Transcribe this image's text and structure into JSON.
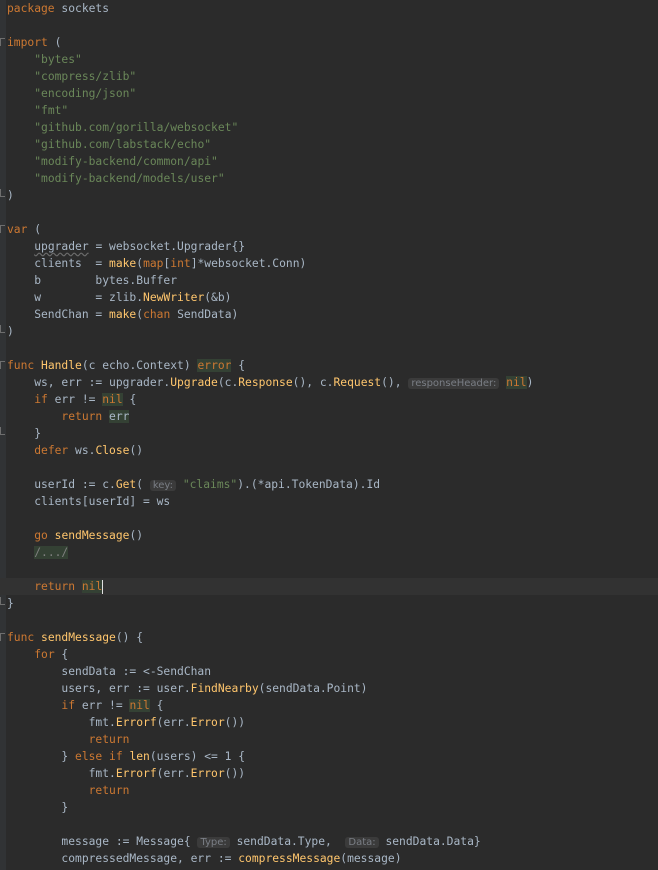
{
  "editor": {
    "lines": [
      [
        {
          "t": "package",
          "k": "kw"
        },
        {
          "t": " sockets",
          "k": "p"
        }
      ],
      [],
      [
        {
          "t": "import",
          "k": "kw"
        },
        {
          "t": " (",
          "k": "p"
        }
      ],
      [
        {
          "t": "    ",
          "k": "p"
        },
        {
          "t": "\"bytes\"",
          "k": "str"
        }
      ],
      [
        {
          "t": "    ",
          "k": "p"
        },
        {
          "t": "\"compress/zlib\"",
          "k": "str"
        }
      ],
      [
        {
          "t": "    ",
          "k": "p"
        },
        {
          "t": "\"encoding/json\"",
          "k": "str"
        }
      ],
      [
        {
          "t": "    ",
          "k": "p"
        },
        {
          "t": "\"fmt\"",
          "k": "str"
        }
      ],
      [
        {
          "t": "    ",
          "k": "p"
        },
        {
          "t": "\"github.com/gorilla/websocket\"",
          "k": "str"
        }
      ],
      [
        {
          "t": "    ",
          "k": "p"
        },
        {
          "t": "\"github.com/labstack/echo\"",
          "k": "str"
        }
      ],
      [
        {
          "t": "    ",
          "k": "p"
        },
        {
          "t": "\"modify-backend/common/api\"",
          "k": "str"
        }
      ],
      [
        {
          "t": "    ",
          "k": "p"
        },
        {
          "t": "\"modify-backend/models/user\"",
          "k": "str"
        }
      ],
      [
        {
          "t": ")",
          "k": "p"
        }
      ],
      [],
      [
        {
          "t": "var",
          "k": "kw"
        },
        {
          "t": " (",
          "k": "p"
        }
      ],
      [
        {
          "t": "    ",
          "k": "p"
        },
        {
          "t": "upgrader",
          "k": "sq"
        },
        {
          "t": " = websocket.Upgrader{}",
          "k": "p"
        }
      ],
      [
        {
          "t": "    clients  = ",
          "k": "p"
        },
        {
          "t": "make",
          "k": "fn"
        },
        {
          "t": "(",
          "k": "p"
        },
        {
          "t": "map",
          "k": "kw"
        },
        {
          "t": "[",
          "k": "p"
        },
        {
          "t": "int",
          "k": "kw"
        },
        {
          "t": "]*websocket.Conn)",
          "k": "p"
        }
      ],
      [
        {
          "t": "    b        bytes.Buffer",
          "k": "p"
        }
      ],
      [
        {
          "t": "    w        = zlib.",
          "k": "p"
        },
        {
          "t": "NewWriter",
          "k": "fn"
        },
        {
          "t": "(&b)",
          "k": "p"
        }
      ],
      [
        {
          "t": "    SendChan = ",
          "k": "p"
        },
        {
          "t": "make",
          "k": "fn"
        },
        {
          "t": "(",
          "k": "p"
        },
        {
          "t": "chan",
          "k": "kw"
        },
        {
          "t": " SendData)",
          "k": "p"
        }
      ],
      [
        {
          "t": ")",
          "k": "p"
        }
      ],
      [],
      [
        {
          "t": "func",
          "k": "kw"
        },
        {
          "t": " ",
          "k": "p"
        },
        {
          "t": "Handle",
          "k": "fn"
        },
        {
          "t": "(c echo.Context) ",
          "k": "p"
        },
        {
          "t": "error",
          "k": "kwhl"
        },
        {
          "t": " {",
          "k": "p"
        }
      ],
      [
        {
          "t": "    ws, err := upgrader.",
          "k": "p"
        },
        {
          "t": "Upgrade",
          "k": "fn"
        },
        {
          "t": "(c.",
          "k": "p"
        },
        {
          "t": "Response",
          "k": "fn"
        },
        {
          "t": "(), c.",
          "k": "p"
        },
        {
          "t": "Request",
          "k": "fn"
        },
        {
          "t": "(), ",
          "k": "p"
        },
        {
          "t": "responseHeader:",
          "k": "hint"
        },
        {
          "t": " ",
          "k": "p"
        },
        {
          "t": "nil",
          "k": "kwhl"
        },
        {
          "t": ")",
          "k": "p"
        }
      ],
      [
        {
          "t": "    ",
          "k": "p"
        },
        {
          "t": "if",
          "k": "kw"
        },
        {
          "t": " err != ",
          "k": "p"
        },
        {
          "t": "nil",
          "k": "kwhl"
        },
        {
          "t": " {",
          "k": "p"
        }
      ],
      [
        {
          "t": "        ",
          "k": "p"
        },
        {
          "t": "return",
          "k": "kw"
        },
        {
          "t": " ",
          "k": "p"
        },
        {
          "t": "err",
          "k": "hl"
        }
      ],
      [
        {
          "t": "    }",
          "k": "p"
        }
      ],
      [
        {
          "t": "    ",
          "k": "p"
        },
        {
          "t": "defer",
          "k": "kw"
        },
        {
          "t": " ws.",
          "k": "p"
        },
        {
          "t": "Close",
          "k": "fn"
        },
        {
          "t": "()",
          "k": "p"
        }
      ],
      [],
      [
        {
          "t": "    userId := c.",
          "k": "p"
        },
        {
          "t": "Get",
          "k": "fn"
        },
        {
          "t": "( ",
          "k": "p"
        },
        {
          "t": "key:",
          "k": "hint"
        },
        {
          "t": " ",
          "k": "p"
        },
        {
          "t": "\"claims\"",
          "k": "str"
        },
        {
          "t": ").(*api.TokenData).Id",
          "k": "p"
        }
      ],
      [
        {
          "t": "    clients[userId] = ws",
          "k": "p"
        }
      ],
      [],
      [
        {
          "t": "    ",
          "k": "p"
        },
        {
          "t": "go",
          "k": "kw"
        },
        {
          "t": " ",
          "k": "p"
        },
        {
          "t": "sendMessage",
          "k": "fn"
        },
        {
          "t": "()",
          "k": "p"
        }
      ],
      [
        {
          "t": "    ",
          "k": "p"
        },
        {
          "t": "/.../",
          "k": "dimhl"
        }
      ],
      [],
      [
        {
          "t": "    ",
          "k": "p"
        },
        {
          "t": "return",
          "k": "kw"
        },
        {
          "t": " ",
          "k": "p"
        },
        {
          "t": "nil",
          "k": "kwhl"
        },
        {
          "t": "",
          "k": "caret"
        }
      ],
      [
        {
          "t": "}",
          "k": "p"
        }
      ],
      [],
      [
        {
          "t": "func",
          "k": "kw"
        },
        {
          "t": " ",
          "k": "p"
        },
        {
          "t": "sendMessage",
          "k": "fn"
        },
        {
          "t": "() {",
          "k": "p"
        }
      ],
      [
        {
          "t": "    ",
          "k": "p"
        },
        {
          "t": "for",
          "k": "kw"
        },
        {
          "t": " {",
          "k": "p"
        }
      ],
      [
        {
          "t": "        sendData := <-SendChan",
          "k": "p"
        }
      ],
      [
        {
          "t": "        users, err := user.",
          "k": "p"
        },
        {
          "t": "FindNearby",
          "k": "fn"
        },
        {
          "t": "(sendData.Point)",
          "k": "p"
        }
      ],
      [
        {
          "t": "        ",
          "k": "p"
        },
        {
          "t": "if",
          "k": "kw"
        },
        {
          "t": " err != ",
          "k": "p"
        },
        {
          "t": "nil",
          "k": "kwhl"
        },
        {
          "t": " {",
          "k": "p"
        }
      ],
      [
        {
          "t": "            fmt.",
          "k": "p"
        },
        {
          "t": "Errorf",
          "k": "fn"
        },
        {
          "t": "(err.",
          "k": "p"
        },
        {
          "t": "Error",
          "k": "fn"
        },
        {
          "t": "())",
          "k": "p"
        }
      ],
      [
        {
          "t": "            ",
          "k": "p"
        },
        {
          "t": "return",
          "k": "kw"
        }
      ],
      [
        {
          "t": "        } ",
          "k": "p"
        },
        {
          "t": "else if",
          "k": "kw"
        },
        {
          "t": " ",
          "k": "p"
        },
        {
          "t": "len",
          "k": "fn"
        },
        {
          "t": "(users) <= 1 {",
          "k": "p"
        }
      ],
      [
        {
          "t": "            fmt.",
          "k": "p"
        },
        {
          "t": "Errorf",
          "k": "fn"
        },
        {
          "t": "(err.",
          "k": "p"
        },
        {
          "t": "Error",
          "k": "fn"
        },
        {
          "t": "())",
          "k": "p"
        }
      ],
      [
        {
          "t": "            ",
          "k": "p"
        },
        {
          "t": "return",
          "k": "kw"
        }
      ],
      [
        {
          "t": "        }",
          "k": "p"
        }
      ],
      [],
      [
        {
          "t": "        message := Message{ ",
          "k": "p"
        },
        {
          "t": "Type:",
          "k": "hint"
        },
        {
          "t": " sendData.Type,  ",
          "k": "p"
        },
        {
          "t": "Data:",
          "k": "hint"
        },
        {
          "t": " sendData.Data}",
          "k": "p"
        }
      ],
      [
        {
          "t": "        compressedMessage, err := ",
          "k": "p"
        },
        {
          "t": "compressMessage",
          "k": "fn"
        },
        {
          "t": "(message)",
          "k": "p"
        }
      ]
    ]
  }
}
